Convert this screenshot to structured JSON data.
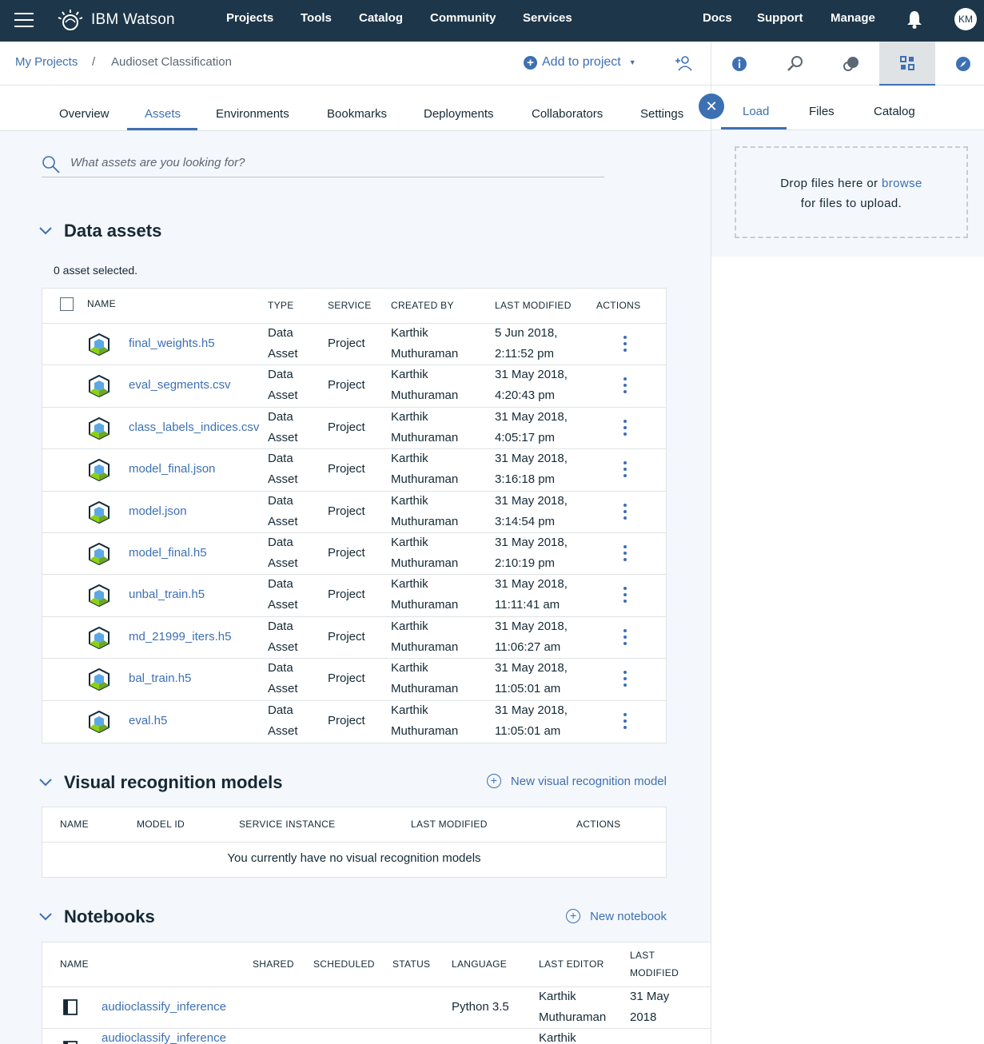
{
  "topnav": {
    "brand": "IBM Watson",
    "links": [
      "Projects",
      "Tools",
      "Catalog",
      "Community",
      "Services"
    ],
    "right_links": [
      "Docs",
      "Support",
      "Manage"
    ],
    "avatar": "KM"
  },
  "breadcrumb": {
    "root": "My Projects",
    "separator": "/",
    "current": "Audioset Classification",
    "add_to_project": "Add to project"
  },
  "tabs": [
    "Overview",
    "Assets",
    "Environments",
    "Bookmarks",
    "Deployments",
    "Collaborators",
    "Settings"
  ],
  "active_tab": "Assets",
  "search": {
    "placeholder": "What assets are you looking for?"
  },
  "data_assets": {
    "title": "Data assets",
    "selected_text": "0 asset selected.",
    "columns": [
      "NAME",
      "TYPE",
      "SERVICE",
      "CREATED BY",
      "LAST MODIFIED",
      "ACTIONS"
    ],
    "rows": [
      {
        "name": "final_weights.h5",
        "type1": "Data",
        "type2": "Asset",
        "service": "Project",
        "by1": "Karthik",
        "by2": "Muthuraman",
        "mod1": "5 Jun 2018,",
        "mod2": "2:11:52 pm"
      },
      {
        "name": "eval_segments.csv",
        "type1": "Data",
        "type2": "Asset",
        "service": "Project",
        "by1": "Karthik",
        "by2": "Muthuraman",
        "mod1": "31 May 2018,",
        "mod2": "4:20:43 pm"
      },
      {
        "name": "class_labels_indices.csv",
        "type1": "Data",
        "type2": "Asset",
        "service": "Project",
        "by1": "Karthik",
        "by2": "Muthuraman",
        "mod1": "31 May 2018,",
        "mod2": "4:05:17 pm"
      },
      {
        "name": "model_final.json",
        "type1": "Data",
        "type2": "Asset",
        "service": "Project",
        "by1": "Karthik",
        "by2": "Muthuraman",
        "mod1": "31 May 2018,",
        "mod2": "3:16:18 pm"
      },
      {
        "name": "model.json",
        "type1": "Data",
        "type2": "Asset",
        "service": "Project",
        "by1": "Karthik",
        "by2": "Muthuraman",
        "mod1": "31 May 2018,",
        "mod2": "3:14:54 pm"
      },
      {
        "name": "model_final.h5",
        "type1": "Data",
        "type2": "Asset",
        "service": "Project",
        "by1": "Karthik",
        "by2": "Muthuraman",
        "mod1": "31 May 2018,",
        "mod2": "2:10:19 pm"
      },
      {
        "name": "unbal_train.h5",
        "type1": "Data",
        "type2": "Asset",
        "service": "Project",
        "by1": "Karthik",
        "by2": "Muthuraman",
        "mod1": "31 May 2018,",
        "mod2": "11:11:41 am"
      },
      {
        "name": "md_21999_iters.h5",
        "type1": "Data",
        "type2": "Asset",
        "service": "Project",
        "by1": "Karthik",
        "by2": "Muthuraman",
        "mod1": "31 May 2018,",
        "mod2": "11:06:27 am"
      },
      {
        "name": "bal_train.h5",
        "type1": "Data",
        "type2": "Asset",
        "service": "Project",
        "by1": "Karthik",
        "by2": "Muthuraman",
        "mod1": "31 May 2018,",
        "mod2": "11:05:01 am"
      },
      {
        "name": "eval.h5",
        "type1": "Data",
        "type2": "Asset",
        "service": "Project",
        "by1": "Karthik",
        "by2": "Muthuraman",
        "mod1": "31 May 2018,",
        "mod2": "11:05:01 am"
      }
    ]
  },
  "visual_recognition": {
    "title": "Visual recognition models",
    "new_link": "New visual recognition model",
    "columns": [
      "NAME",
      "MODEL ID",
      "SERVICE INSTANCE",
      "LAST MODIFIED",
      "ACTIONS"
    ],
    "empty_text": "You currently have no visual recognition models"
  },
  "notebooks": {
    "title": "Notebooks",
    "new_link": "New notebook",
    "columns": [
      "NAME",
      "SHARED",
      "SCHEDULED",
      "STATUS",
      "LANGUAGE",
      "LAST EDITOR",
      "LAST",
      "MODIFIED"
    ],
    "rows": [
      {
        "name": "audioclassify_inference",
        "language": "Python 3.5",
        "editor1": "Karthik",
        "editor2": "Muthuraman",
        "mod1": "31 May",
        "mod2": "2018"
      },
      {
        "name": "audioclassify_inference",
        "language": "",
        "editor1": "Karthik",
        "editor2": "",
        "mod1": "",
        "mod2": ""
      }
    ]
  },
  "right_panel": {
    "tabs": [
      "Load",
      "Files",
      "Catalog"
    ],
    "active_tab": "Load",
    "drop_text_1": "Drop files here or",
    "browse": "browse",
    "drop_text_2": "for files to upload."
  },
  "colors": {
    "nav_bg": "#1d3649",
    "accent": "#3d70b2",
    "page_bg": "#f4f7fb"
  }
}
